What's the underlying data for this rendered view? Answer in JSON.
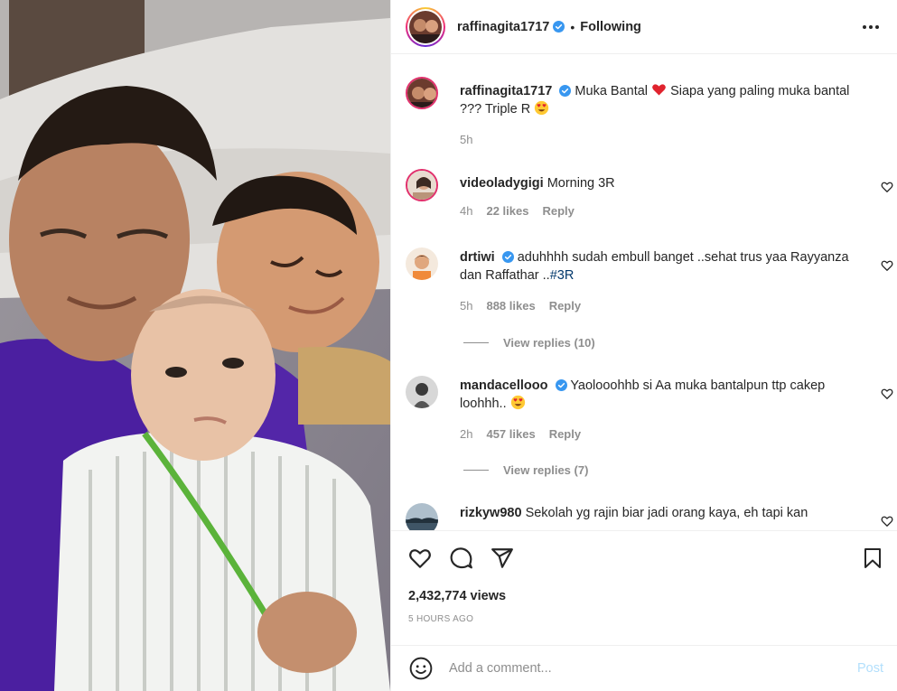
{
  "post": {
    "author": "raffinagita1717",
    "separator": "•",
    "follow_status": "Following",
    "caption_text": "Muka Bantal",
    "caption_rest": "Siapa yang paling muka bantal ??? Triple R",
    "caption_time": "5h"
  },
  "comments": [
    {
      "username": "videoladygigi",
      "text": "Morning 3R",
      "time": "4h",
      "likes": "22 likes",
      "reply": "Reply"
    },
    {
      "username": "drtiwi",
      "text": "aduhhhh sudah embull banget ..sehat trus yaa Rayyanza dan Raffathar ..",
      "hashtag": "#3R",
      "time": "5h",
      "likes": "888 likes",
      "reply": "Reply",
      "view_replies": "View replies (10)"
    },
    {
      "username": "mandacellooo",
      "text": "Yaolooohhb si Aa muka bantalpun ttp cakep loohhh..",
      "time": "2h",
      "likes": "457 likes",
      "reply": "Reply",
      "view_replies": "View replies (7)"
    },
    {
      "username": "rizkyw980",
      "text": "Sekolah yg rajin biar jadi orang kaya, eh tapi kan"
    }
  ],
  "stats": {
    "views": "2,432,774 views",
    "time_ago": "5 HOURS AGO"
  },
  "composer": {
    "placeholder": "Add a comment...",
    "post_label": "Post"
  },
  "icons": {
    "verified": "verified-badge-icon",
    "more": "more-options-icon",
    "like": "heart-icon",
    "comment": "comment-bubble-icon",
    "share": "paper-plane-icon",
    "save": "bookmark-icon",
    "emoji": "smiley-icon"
  },
  "colors": {
    "verified_blue": "#3897f0",
    "muted": "#8e8e8e",
    "hashtag": "#00376b",
    "post_disabled": "#b2dffc"
  }
}
